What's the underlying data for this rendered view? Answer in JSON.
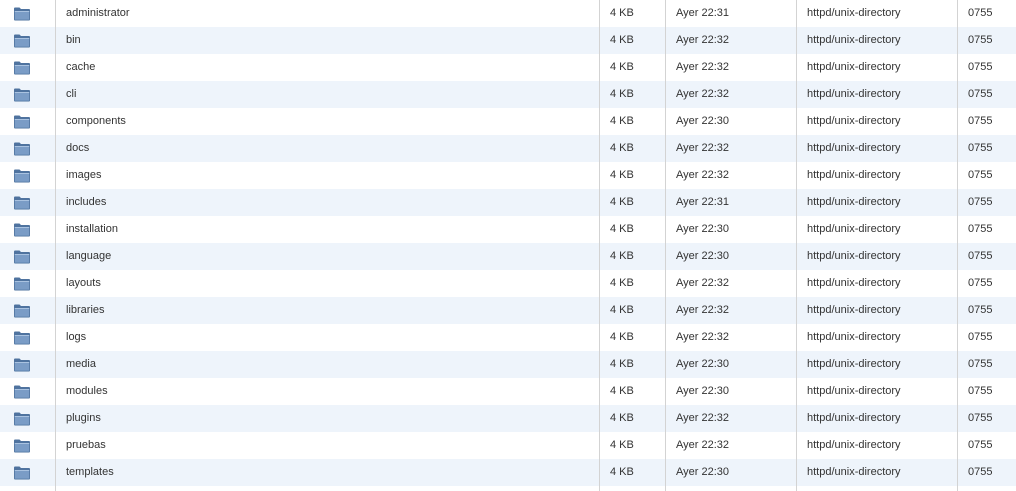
{
  "icons": {
    "folder": "folder-icon"
  },
  "colors": {
    "row_even": "#ffffff",
    "row_odd": "#eef4fb",
    "grid": "#d3d3d3",
    "folder_fill": "#7a9cc6",
    "folder_dark": "#4f739f"
  },
  "rows": [
    {
      "name": "administrator",
      "size": "4 KB",
      "modified": "Ayer 22:31",
      "type": "httpd/unix-directory",
      "perms": "0755"
    },
    {
      "name": "bin",
      "size": "4 KB",
      "modified": "Ayer 22:32",
      "type": "httpd/unix-directory",
      "perms": "0755"
    },
    {
      "name": "cache",
      "size": "4 KB",
      "modified": "Ayer 22:32",
      "type": "httpd/unix-directory",
      "perms": "0755"
    },
    {
      "name": "cli",
      "size": "4 KB",
      "modified": "Ayer 22:32",
      "type": "httpd/unix-directory",
      "perms": "0755"
    },
    {
      "name": "components",
      "size": "4 KB",
      "modified": "Ayer 22:30",
      "type": "httpd/unix-directory",
      "perms": "0755"
    },
    {
      "name": "docs",
      "size": "4 KB",
      "modified": "Ayer 22:32",
      "type": "httpd/unix-directory",
      "perms": "0755"
    },
    {
      "name": "images",
      "size": "4 KB",
      "modified": "Ayer 22:32",
      "type": "httpd/unix-directory",
      "perms": "0755"
    },
    {
      "name": "includes",
      "size": "4 KB",
      "modified": "Ayer 22:31",
      "type": "httpd/unix-directory",
      "perms": "0755"
    },
    {
      "name": "installation",
      "size": "4 KB",
      "modified": "Ayer 22:30",
      "type": "httpd/unix-directory",
      "perms": "0755"
    },
    {
      "name": "language",
      "size": "4 KB",
      "modified": "Ayer 22:30",
      "type": "httpd/unix-directory",
      "perms": "0755"
    },
    {
      "name": "layouts",
      "size": "4 KB",
      "modified": "Ayer 22:32",
      "type": "httpd/unix-directory",
      "perms": "0755"
    },
    {
      "name": "libraries",
      "size": "4 KB",
      "modified": "Ayer 22:32",
      "type": "httpd/unix-directory",
      "perms": "0755"
    },
    {
      "name": "logs",
      "size": "4 KB",
      "modified": "Ayer 22:32",
      "type": "httpd/unix-directory",
      "perms": "0755"
    },
    {
      "name": "media",
      "size": "4 KB",
      "modified": "Ayer 22:30",
      "type": "httpd/unix-directory",
      "perms": "0755"
    },
    {
      "name": "modules",
      "size": "4 KB",
      "modified": "Ayer 22:30",
      "type": "httpd/unix-directory",
      "perms": "0755"
    },
    {
      "name": "plugins",
      "size": "4 KB",
      "modified": "Ayer 22:32",
      "type": "httpd/unix-directory",
      "perms": "0755"
    },
    {
      "name": "pruebas",
      "size": "4 KB",
      "modified": "Ayer 22:32",
      "type": "httpd/unix-directory",
      "perms": "0755"
    },
    {
      "name": "templates",
      "size": "4 KB",
      "modified": "Ayer 22:30",
      "type": "httpd/unix-directory",
      "perms": "0755"
    }
  ]
}
